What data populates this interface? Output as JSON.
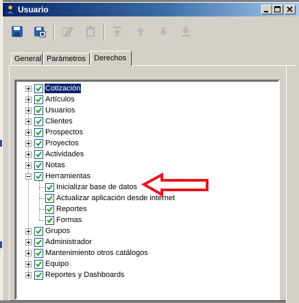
{
  "window": {
    "title": "Usuario",
    "controls": [
      "minimize-icon",
      "maximize-icon",
      "close-icon"
    ]
  },
  "toolbar": {
    "buttons": [
      {
        "name": "save",
        "icon": "floppy-disk-icon",
        "enabled": true
      },
      {
        "name": "save-close",
        "icon": "save-close-icon",
        "enabled": true
      },
      {
        "name": "edit",
        "icon": "pencil-icon",
        "enabled": false
      },
      {
        "name": "delete",
        "icon": "trash-icon",
        "enabled": false
      },
      {
        "name": "first",
        "icon": "arrow-first-icon",
        "enabled": false
      },
      {
        "name": "previous",
        "icon": "arrow-up-icon",
        "enabled": false
      },
      {
        "name": "next",
        "icon": "arrow-down-icon",
        "enabled": false
      },
      {
        "name": "last",
        "icon": "arrow-last-icon",
        "enabled": false
      }
    ]
  },
  "tabs": [
    {
      "label": "General",
      "active": false
    },
    {
      "label": "Parámetros",
      "active": false
    },
    {
      "label": "Derechos",
      "active": true
    }
  ],
  "tree": {
    "items": [
      {
        "label": "Cotización",
        "checked": true,
        "expanded": false,
        "selected": true,
        "level": 0
      },
      {
        "label": "Artículos",
        "checked": true,
        "expanded": false,
        "level": 0
      },
      {
        "label": "Usuarios",
        "checked": true,
        "expanded": false,
        "level": 0
      },
      {
        "label": "Clientes",
        "checked": true,
        "expanded": false,
        "level": 0
      },
      {
        "label": "Prospectos",
        "checked": true,
        "expanded": false,
        "level": 0
      },
      {
        "label": "Proyectos",
        "checked": true,
        "expanded": false,
        "level": 0
      },
      {
        "label": "Actividades",
        "checked": true,
        "expanded": false,
        "level": 0
      },
      {
        "label": "Notas",
        "checked": true,
        "expanded": false,
        "level": 0
      },
      {
        "label": "Herramientas",
        "checked": true,
        "expanded": true,
        "level": 0
      },
      {
        "label": "Inicializar base de datos",
        "checked": true,
        "level": 1,
        "highlighted": true
      },
      {
        "label": "Actualizar aplicación desde internet",
        "checked": true,
        "level": 1
      },
      {
        "label": "Reportes",
        "checked": true,
        "level": 1
      },
      {
        "label": "Formas",
        "checked": true,
        "level": 1
      },
      {
        "label": "Grupos",
        "checked": true,
        "expanded": false,
        "level": 0
      },
      {
        "label": "Administrador",
        "checked": true,
        "expanded": false,
        "level": 0
      },
      {
        "label": "Mantenimiento otros catálogos",
        "checked": true,
        "expanded": false,
        "level": 0
      },
      {
        "label": "Equipo",
        "checked": true,
        "expanded": false,
        "level": 0
      },
      {
        "label": "Reportes y Dashboards",
        "checked": true,
        "expanded": false,
        "level": 0
      }
    ]
  },
  "annotation": {
    "shape": "red-arrow-icon",
    "color": "#e8141c",
    "points_to": "Inicializar base de datos"
  },
  "colors": {
    "titlebar": "#0a246a",
    "selection": "#0a246a",
    "checkbox_border": "#1c5180",
    "check": "#21a121",
    "arrow": "#e8141c"
  }
}
